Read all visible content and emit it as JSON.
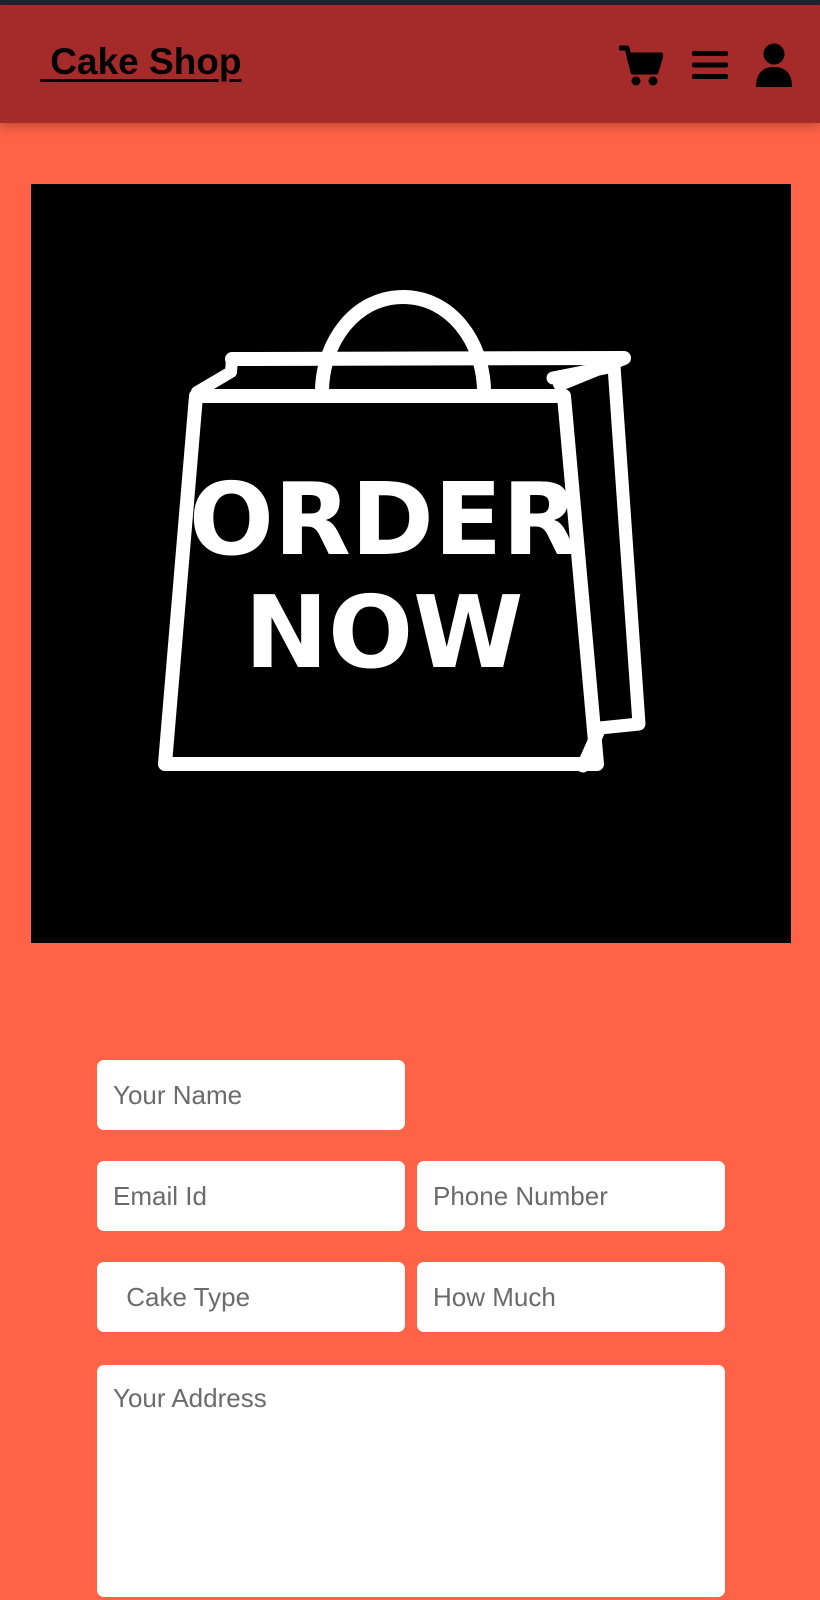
{
  "header": {
    "brand": " Cake Shop",
    "icons": [
      "cart-icon",
      "menu-icon",
      "user-icon"
    ]
  },
  "hero": {
    "line1": "ORDER",
    "line2": "NOW",
    "icon": "shopping-bag-icon"
  },
  "form": {
    "name_placeholder": "Your Name",
    "email_placeholder": "Email Id",
    "phone_placeholder": "Phone Number",
    "cake_type_placeholder": " Cake Type",
    "how_much_placeholder": "How Much",
    "address_placeholder": "Your Address"
  },
  "colors": {
    "background": "#ff6347",
    "header": "#a52a2a",
    "hero_bg": "#000000",
    "field_bg": "#ffffff"
  }
}
